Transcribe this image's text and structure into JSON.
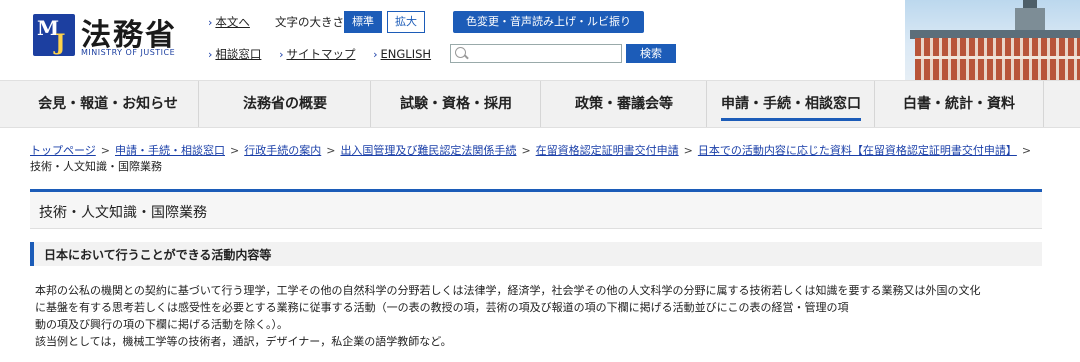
{
  "header": {
    "logo_letters": "MoJ",
    "site_name": "法務省",
    "site_name_en": "MINISTRY OF JUSTICE",
    "skip_link": "本文へ",
    "font_size_label": "文字の大きさ",
    "font_size_standard": "標準",
    "font_size_large": "拡大",
    "accessibility_button": "色変更・音声読み上げ・ルビ振り",
    "consult_link": "相談窓口",
    "sitemap_link": "サイトマップ",
    "english_link": "ENGLISH",
    "search_placeholder": "",
    "search_button": "検索"
  },
  "nav": {
    "items": [
      {
        "label": "会見・報道・お知らせ"
      },
      {
        "label": "法務省の概要"
      },
      {
        "label": "試験・資格・採用"
      },
      {
        "label": "政策・審議会等"
      },
      {
        "label": "申請・手続・相談窓口"
      },
      {
        "label": "白書・統計・資料"
      }
    ]
  },
  "breadcrumb": {
    "items": [
      "トップページ",
      "申請・手続・相談窓口",
      "行政手続の案内",
      "出入国管理及び難民認定法関係手続",
      "在留資格認定証明書交付申請",
      "日本での活動内容に応じた資料【在留資格認定証明書交付申請】"
    ],
    "current": "技術・人文知識・国際業務"
  },
  "page": {
    "title": "技術・人文知識・国際業務",
    "section_title": "日本において行うことができる活動内容等",
    "paragraph_lines": [
      "本邦の公私の機関との契約に基づいて行う理学，工学その他の自然科学の分野若しくは法律学，経済学，社会学その他の人文科学の分野に属する技術若しくは知識を要する業務又は外国の文化",
      "に基盤を有する思考若しくは感受性を必要とする業務に従事する活動（一の表の教授の項，芸術の項及び報道の項の下欄に掲げる活動並びにこの表の経営・管理の項",
      "動の項及び興行の項の下欄に掲げる活動を除く。）。",
      "該当例としては，機械工学等の技術者，通訳，デザイナー，私企業の語学教師など。"
    ]
  },
  "colors": {
    "accent": "#1c5cb8",
    "link": "#1a3fa8",
    "nav_bg": "#f1f1f1"
  }
}
